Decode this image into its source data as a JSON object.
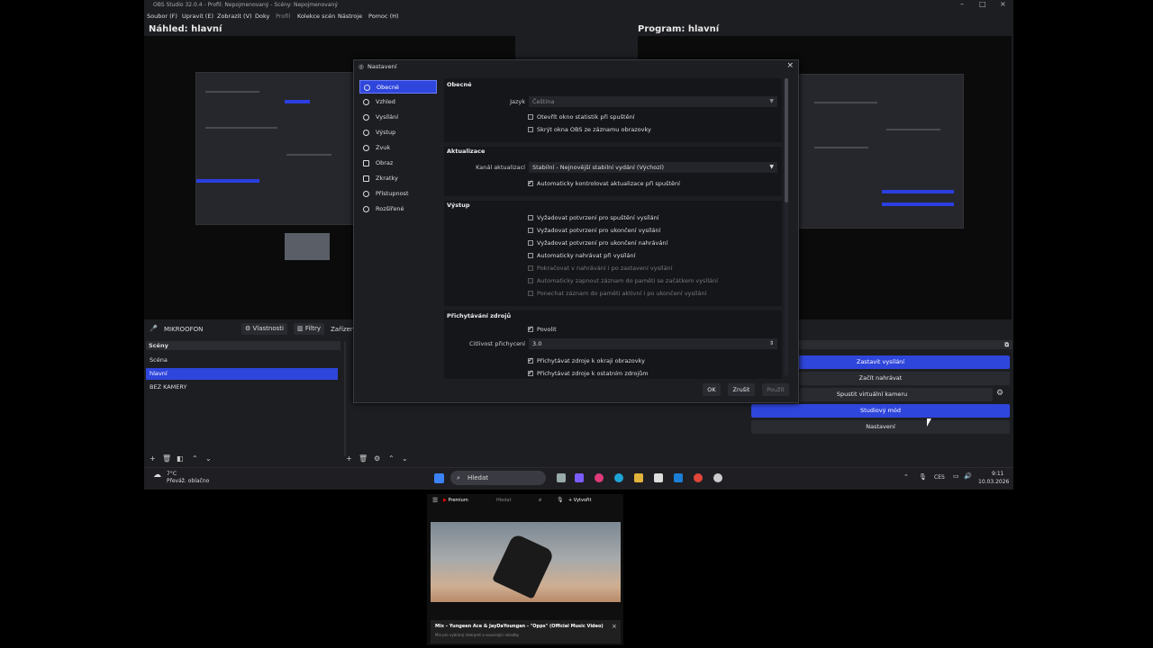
{
  "window": {
    "title": "OBS Studio 32.0.4 - Profil: Nepojmenovaný - Scény: Nepojmenovaný",
    "controls": [
      "–",
      "□",
      "×"
    ]
  },
  "menu": [
    "Soubor (F)",
    "Upravit (E)",
    "Zobrazit (V)",
    "Doky",
    "Profil",
    "Kolekce scén",
    "Nástroje",
    "Pomoc (H)"
  ],
  "preview": {
    "title": "Náhled: hlavní"
  },
  "program": {
    "title": "Program: hlavní"
  },
  "source_toolbar": {
    "source": "MIKROOFON",
    "properties": "Vlastnosti",
    "filters": "Filtry",
    "device": "Zařízení"
  },
  "scenes": {
    "header": "Scény",
    "items": [
      "Scéna",
      "hlavní",
      "BEZ KAMERY"
    ],
    "selected": 1
  },
  "controls": {
    "header": "",
    "buttons": [
      "Zastavit vysílání",
      "Začít nahrávat",
      "Spustit virtuální kameru",
      "Studiový mód",
      "Nastavení"
    ]
  },
  "taskbar": {
    "weather_temp": "7°C",
    "weather_desc": "Převáž. oblačno",
    "search": "Hledat",
    "lang": "CES",
    "time": "9:11",
    "date": "10.03.2026"
  },
  "settings": {
    "title": "Nastavení",
    "sidebar": [
      "Obecné",
      "Vzhled",
      "Vysílání",
      "Výstup",
      "Zvuk",
      "Obraz",
      "Zkratky",
      "Přístupnost",
      "Rozšířené"
    ],
    "general": {
      "title": "Obecné",
      "language_label": "Jazyk",
      "language_value": "Čeština",
      "cb_stats": "Otevřít okno statistik při spuštění",
      "cb_hide": "Skrýt okna OBS ze záznamu obrazovky"
    },
    "updates": {
      "title": "Aktualizace",
      "channel_label": "Kanál aktualizací",
      "channel_value": "Stabilní - Nejnovější stabilní vydání (Výchozí)",
      "cb_auto": "Automaticky kontrolovat aktualizace při spuštění"
    },
    "output": {
      "title": "Výstup",
      "items": [
        "Vyžadovat potvrzení pro spuštění vysílání",
        "Vyžadovat potvrzení pro ukončení vysílání",
        "Vyžadovat potvrzení pro ukončení nahrávání",
        "Automaticky nahrávat při vysílání",
        "Pokračovat v nahrávání i po zastavení vysílání",
        "Automaticky zapnout záznam do paměti se začátkem vysílání",
        "Ponechat záznam do paměti aktivní i po ukončení vysílání"
      ]
    },
    "snapping": {
      "title": "Přichytávání zdrojů",
      "enable": "Povolit",
      "sensitivity_label": "Citlivost přichycení",
      "sensitivity_value": "3.0",
      "cb_edge": "Přichytávat zdroje k okraji obrazovky",
      "cb_other": "Přichytávat zdroje k ostatním zdrojům"
    },
    "buttons": {
      "ok": "OK",
      "cancel": "Zrušit",
      "apply": "Použít"
    }
  },
  "youtube": {
    "logo": "Premium",
    "search": "Hledat",
    "create": "Vytvořit",
    "video_title": "Mix – Yungeen Ace & JayDaYoungan - \"Opps\" (Official Music Video)",
    "subtitle": "Mix pro vybraný interpret a související skladby"
  }
}
